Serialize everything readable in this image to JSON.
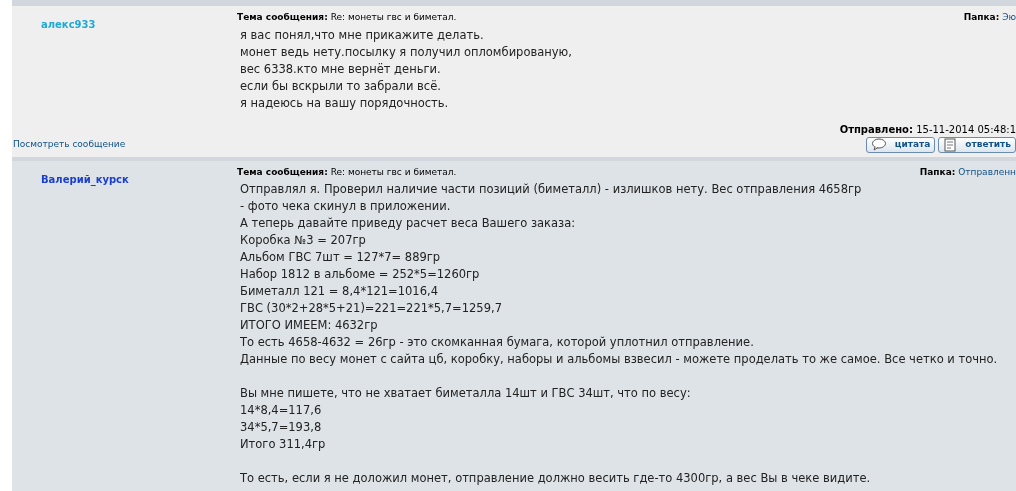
{
  "posts": [
    {
      "author": "алекс933",
      "subject_label": "Тема сообщения:",
      "subject": "Re: монеты гвс и биметал.",
      "folder_label": "Папка:",
      "folder": "Эю",
      "paragraphs": [
        [
          "я вас понял,что мне прикажите делать.",
          "монет ведь нету.посылку я получил опломбированую,",
          "вес 6338.кто мне вернёт деньги.",
          "если бы вскрыли то забрали всё.",
          "я надеюсь на вашу порядочность."
        ]
      ],
      "sent_label": "Отправлено:",
      "sent": "15-11-2014 05:48:1",
      "view_link": "Посмотреть сообщение",
      "buttons": [
        {
          "kind": "quote",
          "label": "цитата"
        },
        {
          "kind": "reply",
          "label": "ответить"
        }
      ]
    },
    {
      "author": "Валерий_курск",
      "subject_label": "Тема сообщения:",
      "subject": "Re: монеты гвс и биметал.",
      "folder_label": "Папка:",
      "folder": "Отправленн",
      "paragraphs": [
        [
          "Отправлял я. Проверил наличие части позиций (биметалл) - излишков нету. Вес отправления 4658гр",
          "- фото чека скинул в приложении.",
          "А теперь давайте приведу расчет веса Вашего заказа:",
          "Коробка №3 = 207гр",
          "Альбом ГВС 7шт = 127*7= 889гр",
          "Набор 1812 в альбоме = 252*5=1260гр",
          "Биметалл 121 = 8,4*121=1016,4",
          "ГВС (30*2+28*5+21)=221=221*5,7=1259,7",
          "ИТОГО ИМЕЕМ: 4632гр",
          "То есть 4658-4632 = 26гр - это скомканная бумага, которой уплотнил отправление.",
          "Данные по весу монет с сайта цб, коробку, наборы и альбомы взвесил - можете проделать то же самое. Все четко и точно."
        ],
        [
          "Вы мне пишете, что не хватает биметалла 14шт и ГВС 34шт, что по весу:",
          "14*8,4=117,6",
          "34*5,7=193,8",
          "Итого 311,4гр"
        ],
        [
          "То есть, если я не доложил монет, отправление должно весить где-то 4300гр, а вес Вы в чеке видите."
        ]
      ]
    }
  ]
}
